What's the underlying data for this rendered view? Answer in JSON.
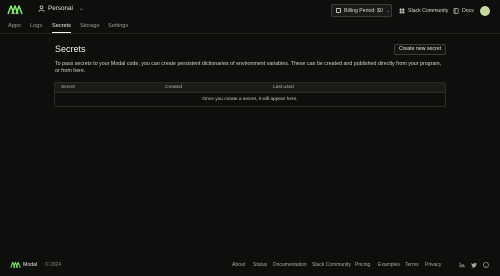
{
  "header": {
    "workspace": "Personal",
    "billing": "Billing Period: $0",
    "slack": "Slack Community",
    "docs": "Docs"
  },
  "tabs": [
    "Apps",
    "Logs",
    "Secrets",
    "Storage",
    "Settings"
  ],
  "page": {
    "title": "Secrets",
    "create_button": "Create new secret",
    "description": "To pass secrets to your Modal code, you can create persistent dictionaries of environment variables. These can be created and published directly from your program, or from here."
  },
  "table": {
    "columns": [
      "Secret",
      "Created",
      "Last used"
    ],
    "empty_message": "Once you create a secret, it will appear here."
  },
  "footer": {
    "brand": "Modal",
    "copyright": "© 2024",
    "links": [
      "About",
      "Status",
      "Documentation",
      "Slack Community",
      "Pricing",
      "Examples",
      "Terms",
      "Privacy"
    ],
    "social_icons": [
      "linkedin-icon",
      "twitter-icon",
      "github-icon"
    ]
  },
  "colors": {
    "background": "#0e0f0c",
    "brand_green": "#7fee64"
  }
}
